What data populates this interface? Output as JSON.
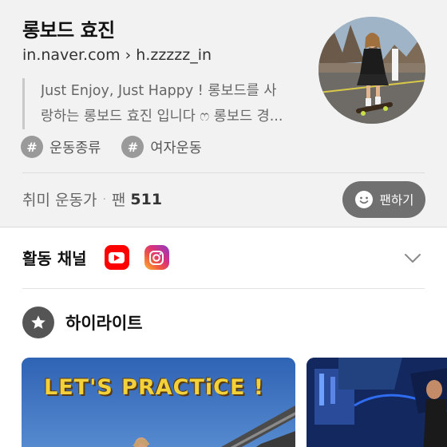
{
  "profile": {
    "name": "롱보드 효진",
    "url_domain": "in.naver.com",
    "url_separator": "›",
    "url_handle": "h.zzzzz_in",
    "intro_line1": "Just Enjoy, Just Happy ! 롱보드를 사",
    "intro_line2": "랑하는 롱보드 효진 입니다 ෆ 롱보드 경...",
    "tags": [
      {
        "symbol": "#",
        "label": "운동종류"
      },
      {
        "symbol": "#",
        "label": "여자운동"
      }
    ]
  },
  "stats": {
    "category": "취미 운동가",
    "separator": "·",
    "fans_label": "팬",
    "fans_count": "511"
  },
  "fan_button": {
    "label": "팬하기",
    "icon": "smile-icon"
  },
  "channels": {
    "title": "활동 채널",
    "items": [
      {
        "icon": "youtube-icon",
        "color": "#ff0000"
      },
      {
        "icon": "instagram-icon",
        "color": "#d8327c"
      }
    ]
  },
  "highlight": {
    "title": "하이라이트",
    "icon": "star-icon",
    "cards": [
      {
        "caption": "LET'S PRACTiCE !"
      },
      {
        "caption": ""
      }
    ]
  },
  "colors": {
    "profile_bg": "#f2f2f2",
    "fan_button_bg": "#707070",
    "youtube_red": "#ff0000",
    "thumb_sky": "#3f78c4",
    "caption_yellow": "#f2d13a"
  }
}
